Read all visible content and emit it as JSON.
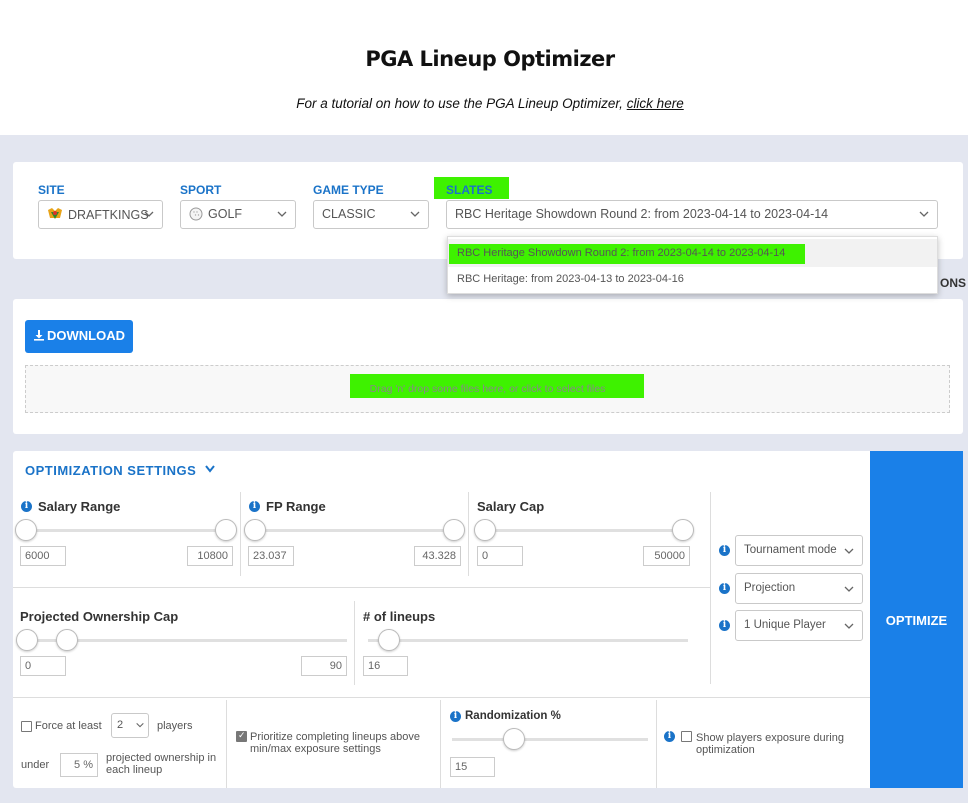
{
  "page": {
    "title": "PGA Lineup Optimizer",
    "subtitle_text": "For a tutorial on how to use the PGA Lineup Optimizer, ",
    "subtitle_link": "click here"
  },
  "filters": {
    "site_label": "SITE",
    "site_value": "DRAFTKINGS",
    "sport_label": "SPORT",
    "sport_value": "GOLF",
    "game_type_label": "GAME TYPE",
    "game_type_value": "CLASSIC",
    "slates_label": "SLATES",
    "slates_value": "RBC Heritage Showdown Round 2: from 2023-04-14 to 2023-04-14",
    "slate_options": [
      "RBC Heritage Showdown Round 2: from 2023-04-14 to 2023-04-14",
      "RBC Heritage: from 2023-04-13 to 2023-04-16"
    ],
    "right_cut_text": "ONS"
  },
  "upload": {
    "download_label": "DOWNLOAD",
    "dropzone_text": "Drag 'n' drop some files here, or click to select files"
  },
  "settings": {
    "header": "OPTIMIZATION SETTINGS",
    "salary_range": {
      "label": "Salary Range",
      "min": "6000",
      "max": "10800"
    },
    "fp_range": {
      "label": "FP Range",
      "min": "23.037",
      "max": "43.328"
    },
    "salary_cap": {
      "label": "Salary Cap",
      "min": "0",
      "max": "50000"
    },
    "ownership_cap": {
      "label": "Projected Ownership Cap",
      "min": "0",
      "max": "90"
    },
    "lineups": {
      "label": "# of lineups",
      "value": "16"
    },
    "mode_select": "Tournament mode",
    "sort_select": "Projection",
    "unique_select": "1 Unique Player",
    "optimize_label": "OPTIMIZE",
    "force_at_least": "Force at least",
    "force_count": "2",
    "players": "players",
    "under": "under",
    "ownership_pct": "5",
    "pct_sign": "%",
    "projected_ownership": "projected ownership in each lineup",
    "prioritize": "Prioritize completing lineups above min/max exposure settings",
    "randomization_label": "Randomization %",
    "randomization_value": "15",
    "show_exposure": "Show players exposure during optimization"
  },
  "colors": {
    "accent": "#1a80e8",
    "highlight": "#3ef200",
    "background": "#e3e6f0"
  }
}
